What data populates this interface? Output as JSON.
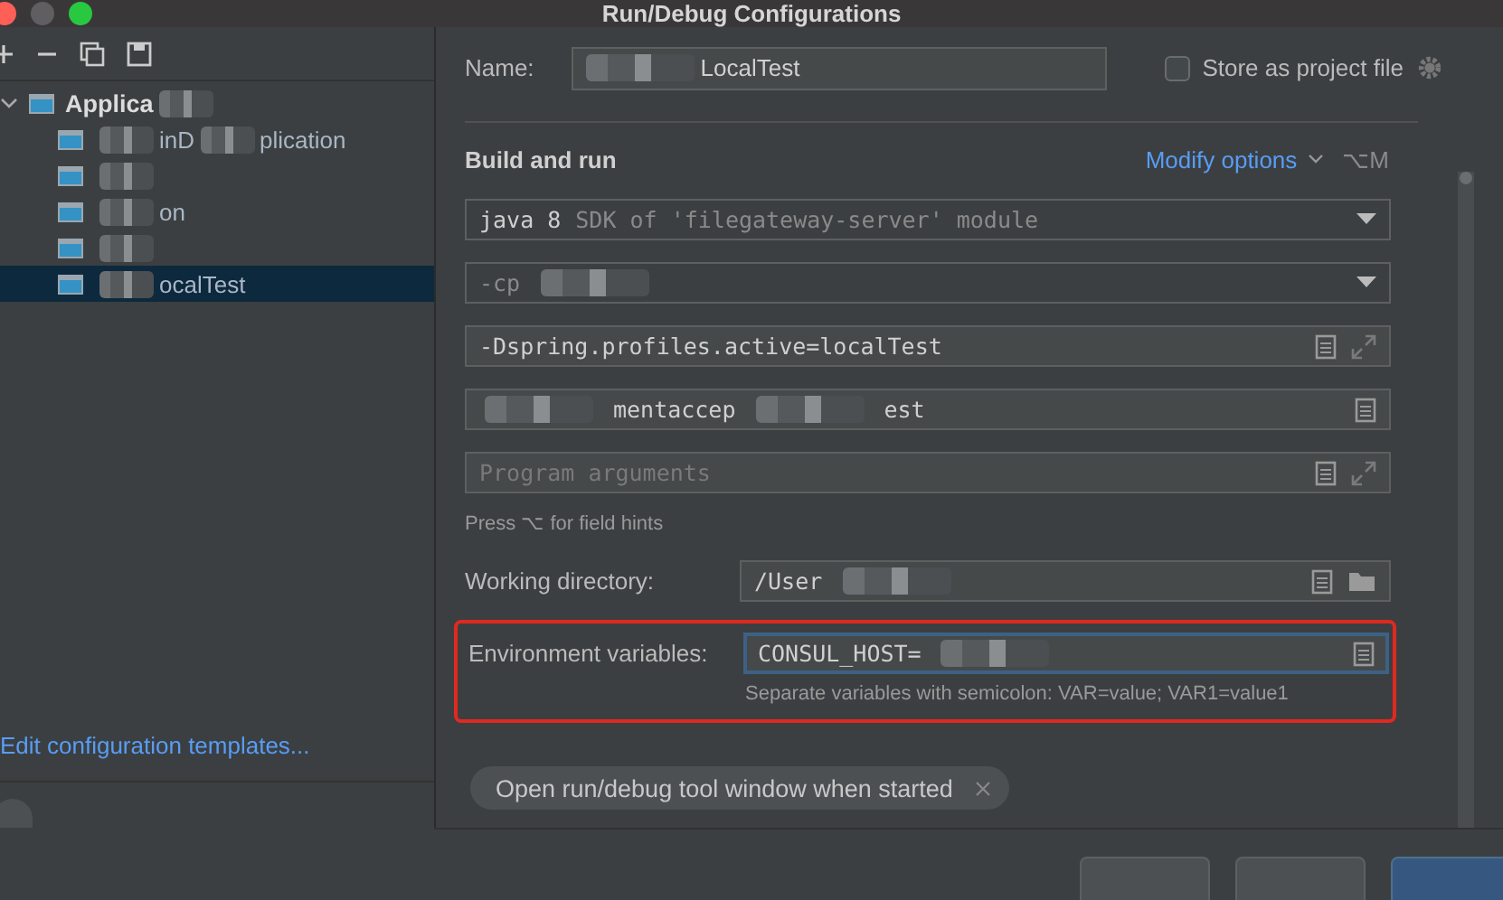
{
  "window": {
    "title": "Run/Debug Configurations"
  },
  "sidebar": {
    "tree": [
      {
        "label": [
          {
            "text": "Applica"
          },
          {
            "kind": "redacted"
          }
        ],
        "expanded": true,
        "children": [
          {
            "label": [
              {
                "kind": "redacted"
              },
              {
                "text": "inD"
              },
              {
                "kind": "redacted"
              },
              {
                "text": "plication"
              }
            ],
            "selected": false
          },
          {
            "label": [
              {
                "kind": "redacted"
              }
            ],
            "selected": false
          },
          {
            "label": [
              {
                "kind": "redacted"
              },
              {
                "text": "on"
              }
            ],
            "selected": false
          },
          {
            "label": [
              {
                "kind": "redacted"
              }
            ],
            "selected": false
          },
          {
            "label": [
              {
                "kind": "redacted"
              },
              {
                "text": "ocalTest"
              }
            ],
            "selected": true
          }
        ]
      }
    ],
    "templates_link": "Edit configuration templates..."
  },
  "form": {
    "name_label": "Name:",
    "name_value": [
      {
        "kind": "redacted"
      },
      {
        "text": "LocalTest"
      }
    ],
    "store_as_project_file": {
      "label": "Store as project file",
      "checked": false
    },
    "section_title": "Build and run",
    "modify_options": "Modify options",
    "modify_shortcut": "⌥M",
    "fields": [
      {
        "kind": "dropdown",
        "value": [
          {
            "text": "java 8"
          },
          {
            "text": "SDK of 'filegateway-server' module",
            "muted": true
          }
        ]
      },
      {
        "kind": "dropdown",
        "value": [
          {
            "text": "-cp",
            "muted": true
          },
          {
            "kind": "redacted"
          }
        ]
      },
      {
        "kind": "expandable",
        "value": [
          {
            "text": "-Dspring.profiles.active=localTest"
          }
        ]
      },
      {
        "kind": "text",
        "value": [
          {
            "kind": "redacted"
          },
          {
            "text": "mentaccep"
          },
          {
            "kind": "redacted"
          },
          {
            "text": "est"
          }
        ]
      },
      {
        "kind": "expandable",
        "placeholder": "Program arguments"
      }
    ],
    "field_hint": "Press ⌥ for field hints",
    "working_directory": {
      "label": "Working directory:",
      "value": [
        {
          "text": "/User"
        },
        {
          "kind": "redacted"
        }
      ]
    },
    "environment": {
      "label": "Environment variables:",
      "value": [
        {
          "text": "CONSUL_HOST="
        },
        {
          "kind": "redacted"
        }
      ],
      "focused": true,
      "highlighted": true,
      "hint": "Separate variables with semicolon: VAR=value; VAR1=value1"
    },
    "option_chips": [
      {
        "label": "Open run/debug tool window when started"
      }
    ]
  },
  "buttons": [
    {
      "kind": "secondary"
    },
    {
      "kind": "secondary"
    },
    {
      "kind": "primary"
    }
  ]
}
